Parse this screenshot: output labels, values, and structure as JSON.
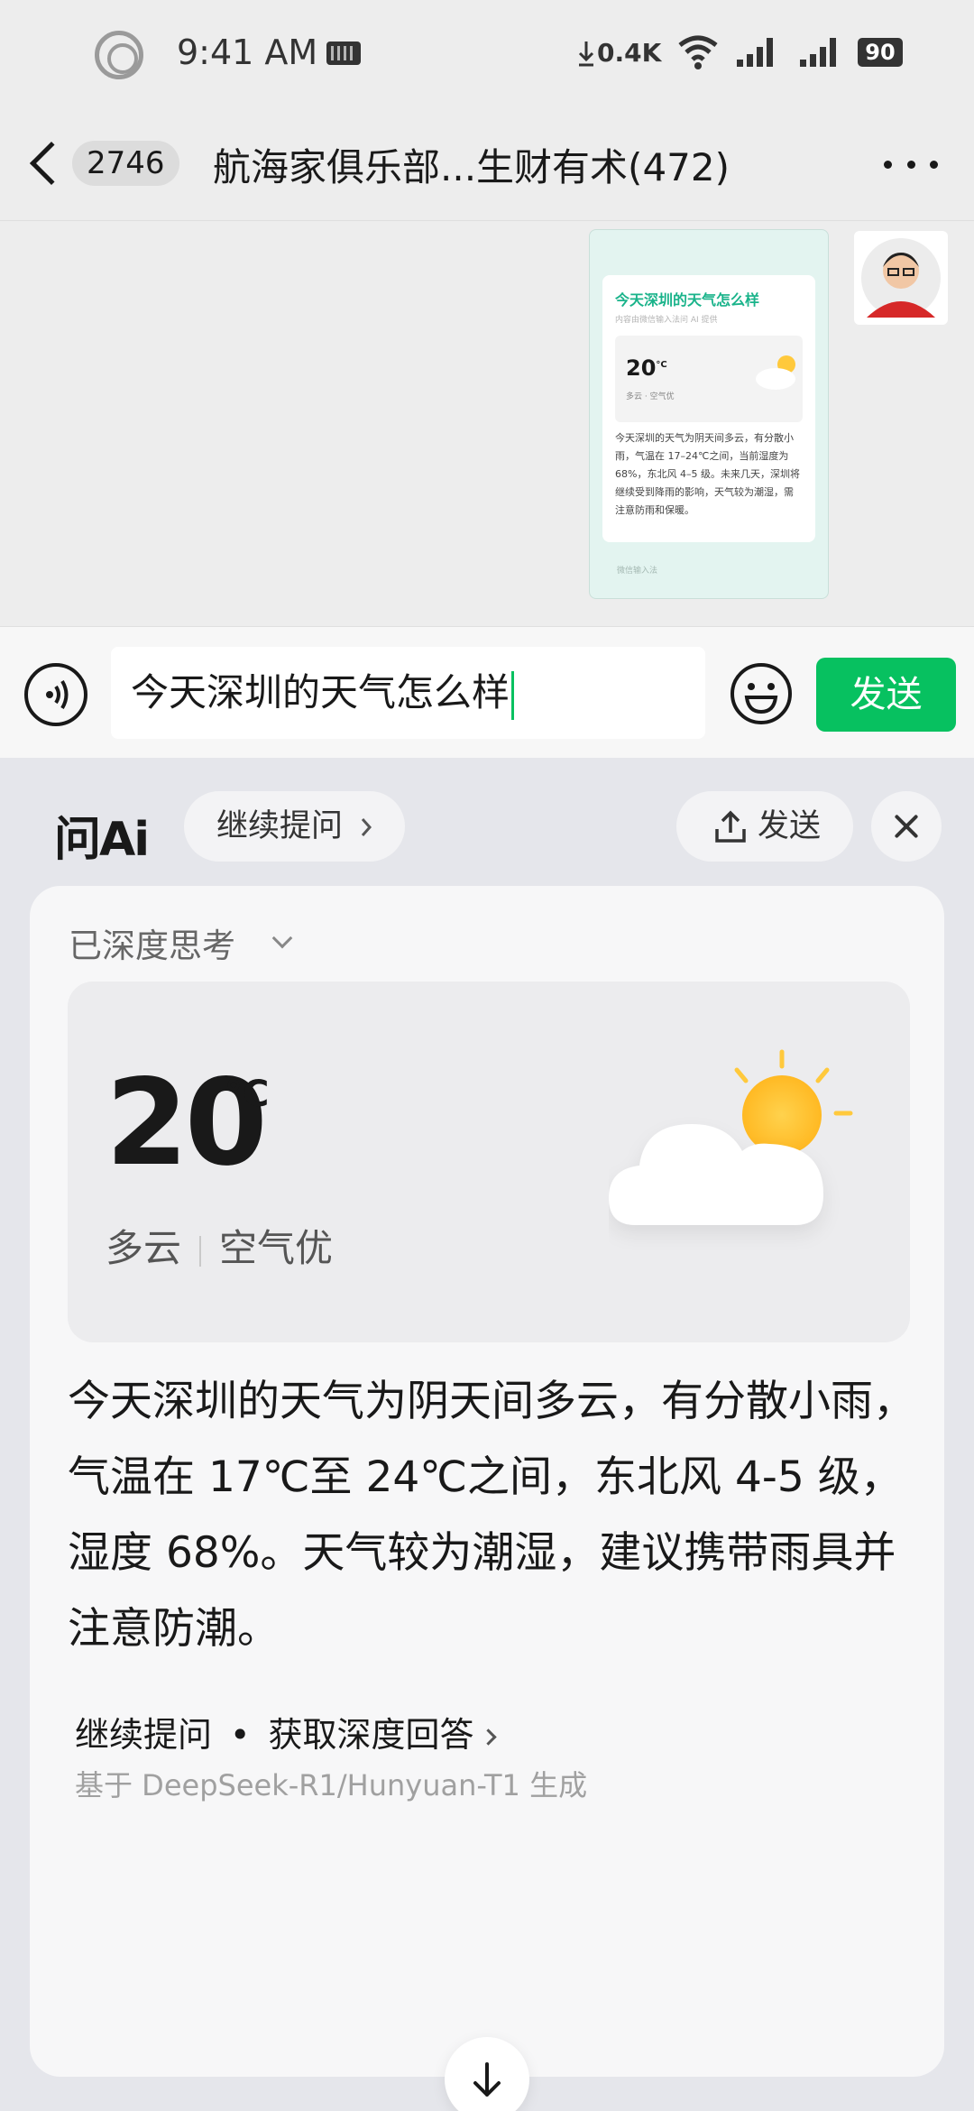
{
  "status_bar": {
    "time": "9:41 AM",
    "net_speed": "0.4K",
    "battery": "90"
  },
  "header": {
    "unread_count": "2746",
    "title": "航海家俱乐部...生财有术(472)"
  },
  "chat": {
    "image_message": {
      "title": "今天深圳的天气怎么样",
      "subtitle": "内容由微信输入法问 AI 提供",
      "temp": "20",
      "temp_unit": "°C",
      "condition": "多云 · 空气优",
      "body": "今天深圳的天气为阴天间多云，有分散小雨，气温在 17–24℃之间，当前湿度为 68%，东北风 4–5 级。未来几天，深圳将继续受到降雨的影响，天气较为潮湿，需注意防雨和保暖。",
      "footer": "微信输入法"
    }
  },
  "input_bar": {
    "text": "今天深圳的天气怎么样",
    "send_label": "发送"
  },
  "ai_panel": {
    "logo": "问Ai",
    "continue_label": "继续提问",
    "share_label": "发送",
    "thinking_label": "已深度思考",
    "weather": {
      "temperature": "20",
      "unit": "°C",
      "condition": "多云",
      "air_quality": "空气优"
    },
    "answer": "今天深圳的天气为阴天间多云，有分散小雨，气温在 17℃至 24℃之间，东北风 4-5 级，湿度 68%。天气较为潮湿，建议携带雨具并注意防潮。",
    "followup_left": "继续提问",
    "followup_right": "获取深度回答",
    "model_note": "基于 DeepSeek-R1/Hunyuan-T1 生成"
  },
  "colors": {
    "accent_green": "#07c160",
    "teal_title": "#19b38a",
    "sun": "#ffc93c"
  },
  "icons": [
    "status-ring-icon",
    "keyboard-icon",
    "download-icon",
    "wifi-icon",
    "signal-icon",
    "battery-icon",
    "back-icon",
    "more-icon",
    "voice-icon",
    "emoji-icon",
    "share-icon",
    "close-icon",
    "chevron-down-icon",
    "chevron-right-icon",
    "arrow-down-icon"
  ]
}
